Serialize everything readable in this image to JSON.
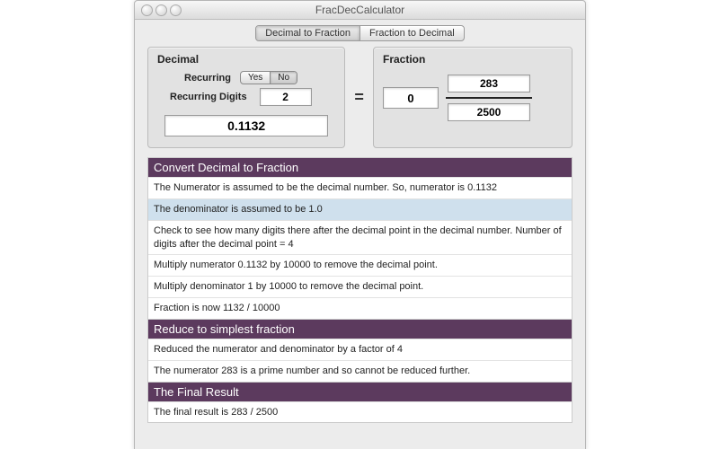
{
  "window": {
    "title": "FracDecCalculator"
  },
  "tabs": {
    "dec_to_frac": "Decimal to Fraction",
    "frac_to_dec": "Fraction to Decimal",
    "selected": 0
  },
  "decimal_panel": {
    "title": "Decimal",
    "recurring_label": "Recurring",
    "yes": "Yes",
    "no": "No",
    "recurring_selected": "no",
    "recurring_digits_label": "Recurring Digits",
    "recurring_digits_value": "2",
    "decimal_value": "0.1132"
  },
  "equals": "=",
  "fraction_panel": {
    "title": "Fraction",
    "whole": "0",
    "numerator": "283",
    "denominator": "2500"
  },
  "sections": {
    "convert": {
      "heading": "Convert Decimal to Fraction",
      "steps": [
        "The Numerator is assumed to be the decimal number.  So, numerator is 0.1132",
        "The denominator is assumed to be 1.0",
        "Check to see how many digits there after the decimal point in the decimal number. Number of digits after the decimal point = 4",
        "Multiply numerator 0.1132 by 10000 to remove the decimal point.",
        "Multiply denominator 1 by 10000 to remove the decimal point.",
        "Fraction is now 1132 / 10000"
      ]
    },
    "reduce": {
      "heading": "Reduce to simplest fraction",
      "steps": [
        "Reduced the numerator and denominator by a factor of 4",
        "The numerator 283 is a prime number and so cannot be reduced further."
      ]
    },
    "final": {
      "heading": "The Final Result",
      "steps": [
        "The final result is 283 / 2500"
      ]
    }
  }
}
